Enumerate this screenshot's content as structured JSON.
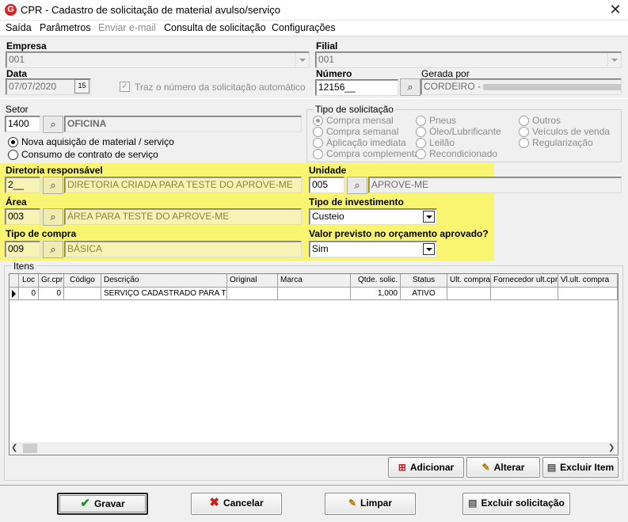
{
  "window": {
    "title": "CPR - Cadastro de solicitação de material avulso/serviço",
    "app_icon": "G",
    "close_glyph": "✕"
  },
  "menu": {
    "items": [
      "Saída",
      "Parâmetros",
      "Enviar e-mail",
      "Consulta de solicitação",
      "Configurações"
    ]
  },
  "header": {
    "empresa_label": "Empresa",
    "empresa_value": "001",
    "filial_label": "Filial",
    "filial_value": "001",
    "data_label": "Data",
    "data_value": "07/07/2020",
    "calendar_glyph": "15",
    "traz_numero_label": "Traz o número da solicitação automático",
    "numero_label": "Número",
    "numero_value": "12156__",
    "gerada_por_label": "Gerada por",
    "gerada_por_value": "CORDEIRO - "
  },
  "setor": {
    "label": "Setor",
    "code": "1400",
    "name": "OFICINA",
    "radio_options": [
      "Nova aquisição de material / serviço",
      "Consumo de contrato de serviço"
    ]
  },
  "tipo_solicitacao": {
    "title": "Tipo de solicitação",
    "options_col1": [
      "Compra mensal",
      "Compra semanal",
      "Aplicação imediata",
      "Compra complementar"
    ],
    "options_col2": [
      "Pneus",
      "Óleo/Lubrificante",
      "Leilão",
      "Recondicionado"
    ],
    "options_col3": [
      "Outros",
      "Veículos de venda",
      "Regularização"
    ]
  },
  "highlight_fields": {
    "diretoria_label": "Diretoria responsável",
    "diretoria_code": "2__",
    "diretoria_name": "DIRETORIA CRIADA PARA TESTE DO APROVE-ME",
    "unidade_label": "Unidade",
    "unidade_code": "005",
    "unidade_name": "APROVE-ME",
    "area_label": "Área",
    "area_code": "003",
    "area_name": "ÁREA PARA TESTE DO APROVE-ME",
    "tipo_investimento_label": "Tipo de investimento",
    "tipo_investimento_value": "Custeio",
    "tipo_compra_label": "Tipo de compra",
    "tipo_compra_code": "009",
    "tipo_compra_name": "BÁSICA",
    "valor_previsto_label": "Valor previsto no orçamento aprovado?",
    "valor_previsto_value": "Sim",
    "highlight_color": "#f9f571"
  },
  "itens": {
    "title": "Itens",
    "columns": [
      "Loc",
      "Gr.cpr",
      "Código",
      "Descrição",
      "Original",
      "Marca",
      "Qtde. solic.",
      "Status",
      "Ult. compra",
      "Fornecedor ult.cpr",
      "Vl.ult. compra"
    ],
    "rows": [
      [
        "0",
        "0",
        "",
        "SERVIÇO CADASTRADO PARA TE",
        "",
        "",
        "1,000",
        "ATIVO",
        "",
        "",
        ""
      ]
    ],
    "buttons": {
      "adicionar": "Adicionar",
      "alterar": "Alterar",
      "excluir_item": "Excluir Item"
    }
  },
  "footer": {
    "gravar": "Gravar",
    "cancelar": "Cancelar",
    "limpar": "Limpar",
    "excluir_solicitacao": "Excluir solicitação"
  },
  "icons": {
    "lookup": "binoculars-icon",
    "gravar": "checkmark-icon",
    "cancelar": "x-icon",
    "limpar": "eraser-icon",
    "excluir": "trash-icon",
    "adicionar": "add-document-icon",
    "alterar": "pencil-icon"
  }
}
